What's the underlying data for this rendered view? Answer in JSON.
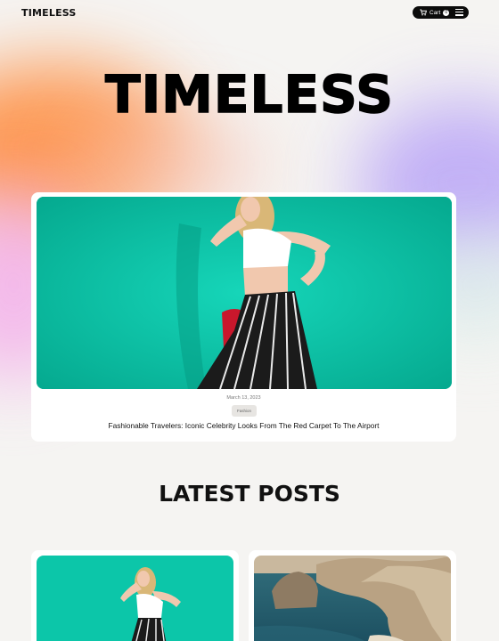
{
  "header": {
    "logo": "TIMELESS",
    "cart_label": "Cart",
    "cart_count": "0"
  },
  "hero": {
    "title": "TIMELESS"
  },
  "featured": {
    "date": "March 13, 2023",
    "tag": "Fashion",
    "title": "Fashionable Travelers: Iconic Celebrity Looks From The Red Carpet To The Airport"
  },
  "latest": {
    "title": "LATEST POSTS"
  },
  "colors": {
    "accent_teal": "#05c2a6",
    "dark": "#0b0b0b",
    "background": "#f5f4f2"
  }
}
